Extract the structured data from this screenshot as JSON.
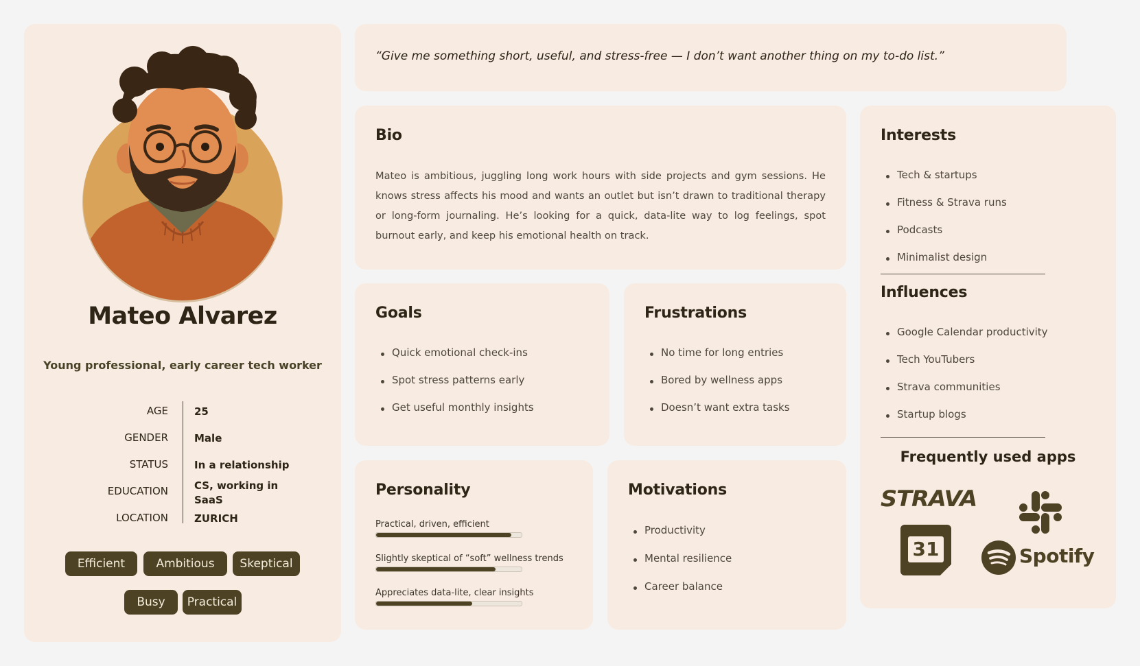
{
  "quote": "“Give me something short, useful, and stress-free — I don’t want another thing on my to-do list.”",
  "profile": {
    "name": "Mateo Alvarez",
    "subtitle": "Young professional, early career tech worker",
    "details": [
      {
        "label": "AGE",
        "value": "25"
      },
      {
        "label": "GENDER",
        "value": "Male"
      },
      {
        "label": "STATUS",
        "value": "In a relationship"
      },
      {
        "label": "EDUCATION",
        "value": "CS, working in SaaS"
      },
      {
        "label": "LOCATION",
        "value": "ZURICH"
      }
    ],
    "tags": [
      "Efficient",
      "Ambitious",
      "Skeptical",
      "Busy",
      "Practical"
    ]
  },
  "bio": {
    "title": "Bio",
    "text": "Mateo is ambitious, juggling long work hours with side projects and gym sessions. He knows stress affects his mood and wants an outlet but isn’t drawn to traditional therapy or long-form journaling. He’s looking for a quick, data-lite way to log feelings, spot burnout early, and keep his emotional health on track."
  },
  "goals": {
    "title": "Goals",
    "items": [
      "Quick emotional check-ins",
      "Spot stress patterns early",
      "Get useful monthly insights"
    ]
  },
  "frustrations": {
    "title": "Frustrations",
    "items": [
      "No time for long entries",
      "Bored by wellness apps",
      "Doesn’t want extra tasks"
    ]
  },
  "personality": {
    "title": "Personality",
    "traits": [
      {
        "label": "Practical, driven, efficient",
        "level": 0.93
      },
      {
        "label": "Slightly skeptical of “soft” wellness trends",
        "level": 0.82
      },
      {
        "label": "Appreciates data-lite, clear insights",
        "level": 0.66
      }
    ]
  },
  "motivations": {
    "title": "Motivations",
    "items": [
      "Productivity",
      "Mental resilience",
      "Career balance"
    ]
  },
  "interests": {
    "title": "Interests",
    "items": [
      "Tech & startups",
      "Fitness & Strava runs",
      "Podcasts",
      "Minimalist design"
    ]
  },
  "influences": {
    "title": "Influences",
    "items": [
      "Google Calendar productivity",
      "Tech YouTubers",
      "Strava communities",
      "Startup blogs"
    ]
  },
  "apps": {
    "title": "Frequently used apps",
    "strava": "STRAVA",
    "calendar_day": "31",
    "spotify": "Spotify"
  },
  "colors": {
    "card": "#f7ebe2",
    "accent": "#4d4224",
    "background": "#f4f4f4"
  }
}
